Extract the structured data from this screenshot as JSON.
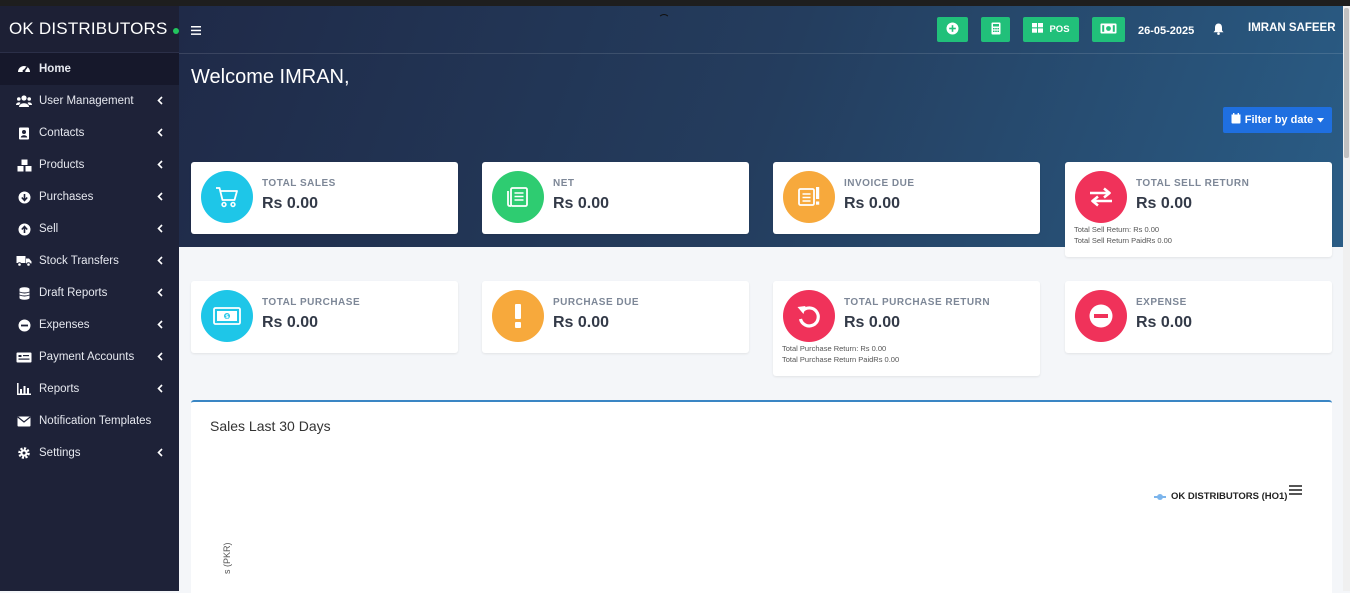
{
  "brand": {
    "name": "OK DISTRIBUTORS",
    "status_color": "#22c55e"
  },
  "sidebar": {
    "items": [
      {
        "label": "Home",
        "icon": "dashboard-icon",
        "active": true,
        "has_children": false
      },
      {
        "label": "User Management",
        "icon": "users-icon",
        "has_children": true
      },
      {
        "label": "Contacts",
        "icon": "address-book-icon",
        "has_children": true
      },
      {
        "label": "Products",
        "icon": "cubes-icon",
        "has_children": true
      },
      {
        "label": "Purchases",
        "icon": "arrow-circle-down-icon",
        "has_children": true
      },
      {
        "label": "Sell",
        "icon": "arrow-circle-up-icon",
        "has_children": true
      },
      {
        "label": "Stock Transfers",
        "icon": "truck-icon",
        "has_children": true
      },
      {
        "label": "Draft Reports",
        "icon": "database-icon",
        "has_children": true
      },
      {
        "label": "Expenses",
        "icon": "minus-circle-icon",
        "has_children": true
      },
      {
        "label": "Payment Accounts",
        "icon": "money-check-icon",
        "has_children": true
      },
      {
        "label": "Reports",
        "icon": "bar-chart-icon",
        "has_children": true
      },
      {
        "label": "Notification Templates",
        "icon": "envelope-icon",
        "has_children": false
      },
      {
        "label": "Settings",
        "icon": "cog-icon",
        "has_children": true
      }
    ]
  },
  "navbar": {
    "pos_label": "POS",
    "date": "26-05-2025",
    "user": "IMRAN SAFEER"
  },
  "welcome": "Welcome IMRAN,",
  "filter_label": "Filter by date",
  "cards": [
    {
      "label": "TOTAL SALES",
      "value": "Rs 0.00",
      "color": "#1ec6e8",
      "icon": "cart-icon"
    },
    {
      "label": "NET",
      "value": "Rs 0.00",
      "color": "#2ecc71",
      "icon": "list-icon"
    },
    {
      "label": "INVOICE DUE",
      "value": "Rs 0.00",
      "color": "#f7a93c",
      "icon": "invoice-alert-icon"
    },
    {
      "label": "TOTAL SELL RETURN",
      "value": "Rs 0.00",
      "color": "#f0325a",
      "icon": "exchange-icon",
      "sub": [
        "Total Sell Return: Rs 0.00",
        "Total Sell Return PaidRs 0.00"
      ]
    },
    {
      "label": "TOTAL PURCHASE",
      "value": "Rs 0.00",
      "color": "#1ec6e8",
      "icon": "money-bill-icon"
    },
    {
      "label": "PURCHASE DUE",
      "value": "Rs 0.00",
      "color": "#f7a93c",
      "icon": "exclamation-icon"
    },
    {
      "label": "TOTAL PURCHASE RETURN",
      "value": "Rs 0.00",
      "color": "#f0325a",
      "icon": "undo-icon",
      "sub": [
        "Total Purchase Return: Rs 0.00",
        "Total Purchase Return PaidRs 0.00"
      ]
    },
    {
      "label": "EXPENSE",
      "value": "Rs 0.00",
      "color": "#f0325a",
      "icon": "minus-circle-icon"
    }
  ],
  "chart": {
    "title": "Sales Last 30 Days",
    "legend": "OK DISTRIBUTORS (HO1)",
    "ylabel_fragment": "s (PKR)"
  }
}
